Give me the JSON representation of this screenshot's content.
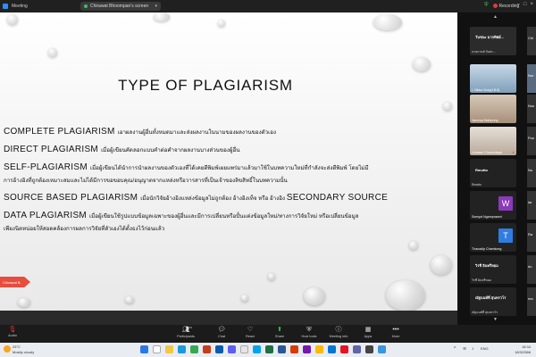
{
  "window": {
    "app_title": "Meeting",
    "share_label": "Chirawat Bhoompan's screen",
    "recording_label": "Recording",
    "view_label": "View"
  },
  "slide": {
    "title": "TYPE OF PLAGIARISM",
    "lines": [
      {
        "head": "COMPLETE PLAGIARISM",
        "text": "เอาผลงานผู้อื่นทั้งหมดมาและส่งผลงานในนามของผลงานของตัวเอง",
        "tail": ""
      },
      {
        "head": "DIRECT PLAGIARISM",
        "text": "เมื่อผู้เขียนคัดลอกแบบคำต่อคำจากผลงานบางส่วนของผู้อื่น",
        "tail": ""
      },
      {
        "head": "SELF-PLAGIARISM",
        "text": "เมื่อผู้เขียนได้นำการนำผลงานของตัวเองที่ได้เคยตีพิมพ์เผยแพร่มาแล้วมาใช้ในบทความใหม่ที่กำลังจะส่งตีพิมพ์ โดยไม่มี",
        "tail": ""
      },
      {
        "head": "",
        "text": "การอ้างอิงที่ถูกต้องเหมาะสมและไม่ได้มีการขอขอบคุณ/อนุญาตจากแหล่งหรือวารสารที่เป็นเจ้าของลิขสิทธิ์ในบทความนั้น",
        "tail": ""
      },
      {
        "head": "SOURCE BASED PLAGIARISM",
        "text": "เมื่อนักวิจัยอ้างอิงแหล่งข้อมูลไม่ถูกต้อง อ้างอิงเท็จ หรือ อ้างอิง",
        "tail": "SECONDARY SOURCE"
      },
      {
        "head": "DATA PLAGIARISM",
        "text": "เมื่อผู้เขียนใช้รูปแบบข้อมูลเฉพาะของผู้อื่นและมีการเปลี่ยนหรือปั้นแต่งข้อมูลใหม่/ทางการวิจัยใหม่ หรือเปลี่ยนข้อมูล",
        "tail": ""
      },
      {
        "head": "",
        "text": "เพียงนิดหน่อยให้สอดคล้องการผลการวิจัยที่ตัวเองได้ตั้งธงไว้ก่อนแล้ว",
        "tail": ""
      }
    ],
    "presenter_tag": "Chirawat B."
  },
  "participants": {
    "tiles": [
      {
        "name": "วันชนะ มากทิพย์..."
      },
      {
        "name": "นายกานต์ กันทะ..."
      },
      {
        "name": "I. Nikka Vicky(I.B.8)",
        "tag": "Chi"
      },
      {
        "name": "Varunya Bathpring",
        "tag": "Nor"
      },
      {
        "name": "Uraiwan Chanchaiyal"
      },
      {
        "name": "Rmutto",
        "sub": "Rmutto"
      },
      {
        "name": "Somyot Ngampraseri",
        "initial": "W"
      },
      {
        "name": "Thanadip Chamkong",
        "initial": "T"
      },
      {
        "name": "วิรชี อินทรีหอม",
        "sub": "วิรชี อินทรีหอม"
      },
      {
        "name": "ณัฐนนท์ที่ สุนทรวโร",
        "sub": "ณัฐนนท์ที่ สุนทรวโร"
      }
    ],
    "edge_labels": [
      "Chi",
      "Nor",
      "Nus",
      "Poo",
      "Nu",
      "lar",
      "Ra",
      "du",
      "ma",
      "Ma"
    ]
  },
  "toolbar": {
    "audio_label": "Audio",
    "items": [
      {
        "label": "Participants",
        "icon": "people-icon",
        "count": "279"
      },
      {
        "label": "Chat",
        "icon": "chat-icon"
      },
      {
        "label": "React",
        "icon": "heart-icon"
      },
      {
        "label": "Share",
        "icon": "share-icon"
      },
      {
        "label": "Host tools",
        "icon": "shield-icon"
      },
      {
        "label": "Meeting info",
        "icon": "info-icon"
      },
      {
        "label": "Apps",
        "icon": "apps-icon"
      },
      {
        "label": "More",
        "icon": "more-icon"
      }
    ]
  },
  "taskbar": {
    "temp": "25°C",
    "weather": "Mostly cloudy",
    "lang": "ENG",
    "time": "18:34",
    "date": "18/3/2568"
  },
  "colors": {
    "accent_blue": "#2d8cff",
    "rec_red": "#e03b3b",
    "tag_red": "#e74c3c",
    "avatar_purple": "#8a3ab9"
  }
}
